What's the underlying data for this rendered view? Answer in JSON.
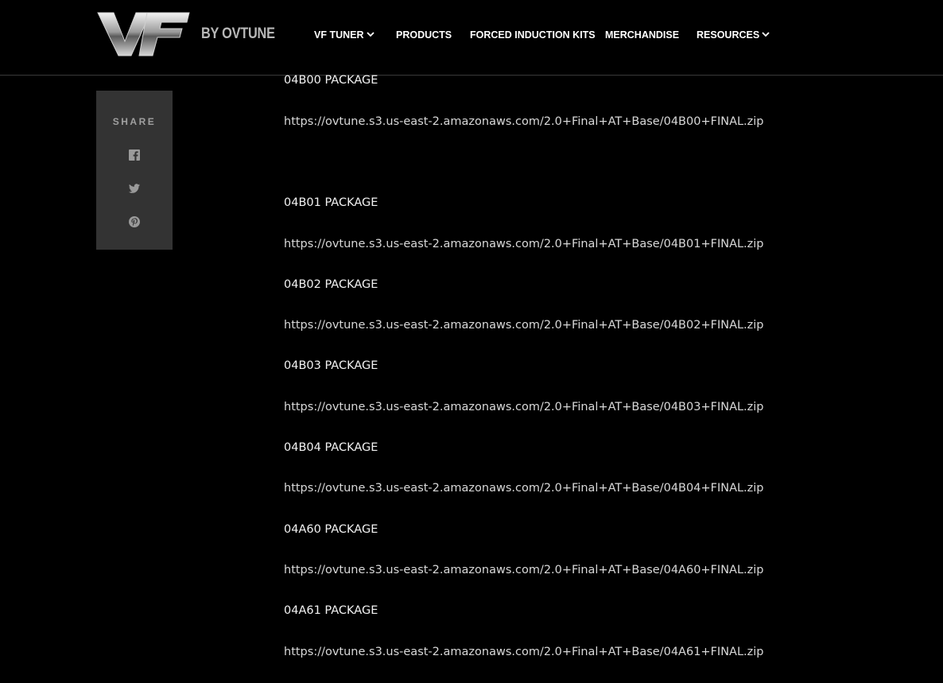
{
  "header": {
    "logo_by_text": "BY OVTUNE",
    "nav": [
      {
        "label": "VF TUNER",
        "has_dropdown": true
      },
      {
        "label": "PRODUCTS",
        "has_dropdown": false
      },
      {
        "label": "FORCED INDUCTION KITS",
        "has_dropdown": false
      },
      {
        "label": "MERCHANDISE",
        "has_dropdown": false
      },
      {
        "label": "RESOURCES",
        "has_dropdown": true
      }
    ]
  },
  "share": {
    "label": "SHARE",
    "icons": [
      "facebook-icon",
      "twitter-icon",
      "pinterest-icon"
    ]
  },
  "packages": [
    {
      "title": "04B00 PACKAGE",
      "url": "https://ovtune.s3.us-east-2.amazonaws.com/2.0+Final+AT+Base/04B00+FINAL.zip"
    },
    {
      "title": "04B01 PACKAGE",
      "url": "https://ovtune.s3.us-east-2.amazonaws.com/2.0+Final+AT+Base/04B01+FINAL.zip"
    },
    {
      "title": "04B02 PACKAGE",
      "url": "https://ovtune.s3.us-east-2.amazonaws.com/2.0+Final+AT+Base/04B02+FINAL.zip"
    },
    {
      "title": "04B03 PACKAGE",
      "url": "https://ovtune.s3.us-east-2.amazonaws.com/2.0+Final+AT+Base/04B03+FINAL.zip"
    },
    {
      "title": "04B04 PACKAGE",
      "url": "https://ovtune.s3.us-east-2.amazonaws.com/2.0+Final+AT+Base/04B04+FINAL.zip"
    },
    {
      "title": "04A60 PACKAGE",
      "url": "https://ovtune.s3.us-east-2.amazonaws.com/2.0+Final+AT+Base/04A60+FINAL.zip"
    },
    {
      "title": "04A61 PACKAGE",
      "url": "https://ovtune.s3.us-east-2.amazonaws.com/2.0+Final+AT+Base/04A61+FINAL.zip"
    }
  ],
  "colors": {
    "background": "#000000",
    "share_box": "#333333",
    "text": "#f2f2f2"
  }
}
